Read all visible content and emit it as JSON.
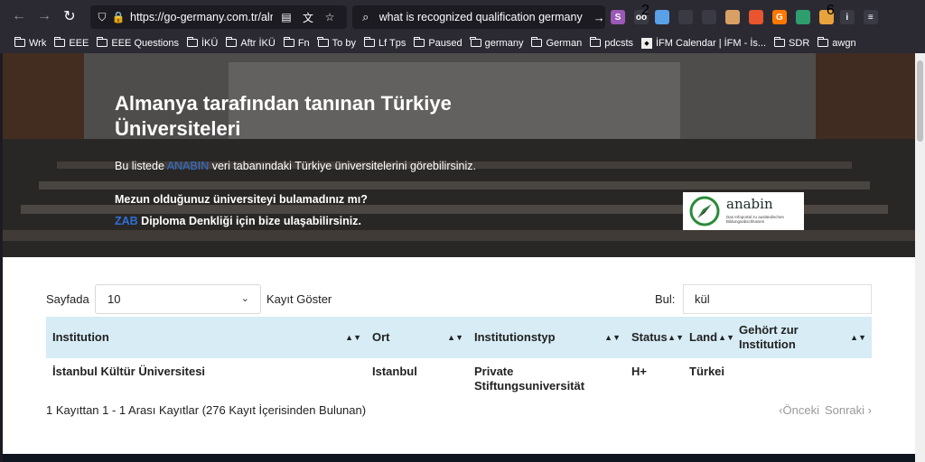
{
  "browser": {
    "url": "https://go-germany.com.tr/alma",
    "search_query": "what is recognized qualification germany",
    "extensions": [
      {
        "name": "s-ext-icon",
        "label": "S",
        "color": "#9b59b6",
        "badge": ""
      },
      {
        "name": "ext-2-icon",
        "label": "oo",
        "color": "#3a3a44",
        "badge": "2"
      },
      {
        "name": "ext-blue-icon",
        "label": "",
        "color": "#5aa0e8",
        "badge": ""
      },
      {
        "name": "puzzle-icon",
        "label": "",
        "color": "#3a3a44",
        "badge": ""
      },
      {
        "name": "grid-icon",
        "label": "",
        "color": "#3a3a44",
        "badge": ""
      },
      {
        "name": "face-icon",
        "label": "",
        "color": "#d9a066",
        "badge": ""
      },
      {
        "name": "flag-icon",
        "label": "",
        "color": "#e8552e",
        "badge": ""
      },
      {
        "name": "g-ext-icon",
        "label": "G",
        "color": "#ff7700",
        "badge": ""
      },
      {
        "name": "shield-ext-icon",
        "label": "",
        "color": "#2e9e6e",
        "badge": ""
      },
      {
        "name": "ext-6-icon",
        "label": "",
        "color": "#e8a33e",
        "badge": "6"
      },
      {
        "name": "info-icon",
        "label": "i",
        "color": "#3a3a44",
        "badge": ""
      },
      {
        "name": "menu-icon",
        "label": "≡",
        "color": "#3a3a44",
        "badge": ""
      }
    ],
    "bookmarks": [
      {
        "label": "Wrk",
        "type": "folder"
      },
      {
        "label": "EEE",
        "type": "folder"
      },
      {
        "label": "EEE Questions",
        "type": "folder"
      },
      {
        "label": "İKÜ",
        "type": "folder"
      },
      {
        "label": "Aftr İKÜ",
        "type": "folder"
      },
      {
        "label": "Fn",
        "type": "folder"
      },
      {
        "label": "To by",
        "type": "folder"
      },
      {
        "label": "Lf Tps",
        "type": "folder"
      },
      {
        "label": "Paused",
        "type": "folder"
      },
      {
        "label": "germany",
        "type": "folder"
      },
      {
        "label": "German",
        "type": "folder"
      },
      {
        "label": "pdcsts",
        "type": "folder"
      },
      {
        "label": "İFM Calendar | İFM - İs...",
        "type": "site"
      },
      {
        "label": "SDR",
        "type": "folder"
      },
      {
        "label": "awgn",
        "type": "folder"
      }
    ]
  },
  "hero": {
    "title": "Almanya tarafından tanınan Türkiye Üniversiteleri",
    "desc_before": "Bu listede ",
    "desc_link": "ANABIN",
    "desc_after": " veri tabanındaki Türkiye üniversitelerini görebilirsiniz.",
    "question": "Mezun olduğunuz üniversiteyi bulamadınız mı?",
    "contact_link": "ZAB",
    "contact_rest": " Diploma Denkliği için bize ulaşabilirsiniz.",
    "logo_word": "anabin",
    "logo_sub": "Das Infoportal zu ausländischen Bildungsabschlüssen"
  },
  "table": {
    "length_label": "Sayfada",
    "length_value": "10",
    "length_after": "Kayıt Göster",
    "filter_label": "Bul:",
    "filter_value": "kül",
    "columns": [
      "Institution",
      "Ort",
      "Institutionstyp",
      "Status",
      "Land",
      "Gehört zur Institution"
    ],
    "rows": [
      [
        "İstanbul Kültür Üniversitesi",
        "Istanbul",
        "Private Stiftungsuniversität",
        "H+",
        "Türkei",
        ""
      ]
    ],
    "info": "1 Kayıttan 1 - 1 Arası Kayıtlar (276 Kayıt İçerisinden Bulunan)",
    "prev": "‹Önceki",
    "next": "Sonraki ›"
  }
}
